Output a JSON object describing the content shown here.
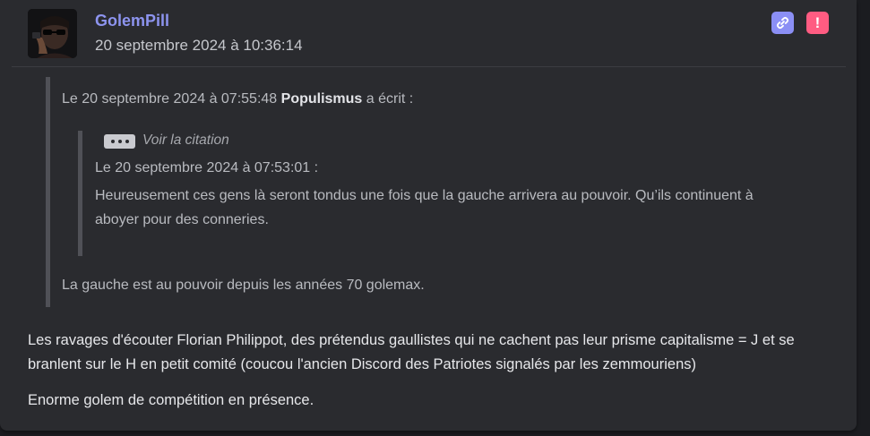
{
  "post": {
    "author": "GolemPill",
    "date": "20 septembre 2024 à 10:36:14",
    "actions": {
      "link_icon": "link-icon",
      "report_icon": "exclamation-icon",
      "report_label": "!"
    },
    "quote": {
      "header_prefix": "Le 20 septembre 2024 à 07:55:48",
      "header_author": "Populismus",
      "header_suffix": "a écrit :",
      "nested": {
        "toggle_label": "Voir la citation",
        "header": "Le 20 septembre 2024 à 07:53:01 :",
        "text": "Heureusement ces gens là seront tondus une fois que la gauche arrivera au pouvoir. Qu’ils continuent à aboyer pour des conneries."
      },
      "text": "La gauche est au pouvoir depuis les années 70 golemax."
    },
    "body": [
      "Les ravages d'écouter Florian Philippot, des prétendus gaullistes qui ne cachent pas leur prisme capitalisme = J et se branlent sur le H en petit comité (coucou l'ancien Discord des Patriotes signalés par les zemmouriens)",
      "Enorme golem de compétition en présence."
    ]
  },
  "colors": {
    "background": "#1b1c20",
    "card": "#2a2b2f",
    "author": "#8d94ef",
    "link_button": "#8b8ff5",
    "report_button": "#ff5c82",
    "quote_bar": "#505157"
  }
}
